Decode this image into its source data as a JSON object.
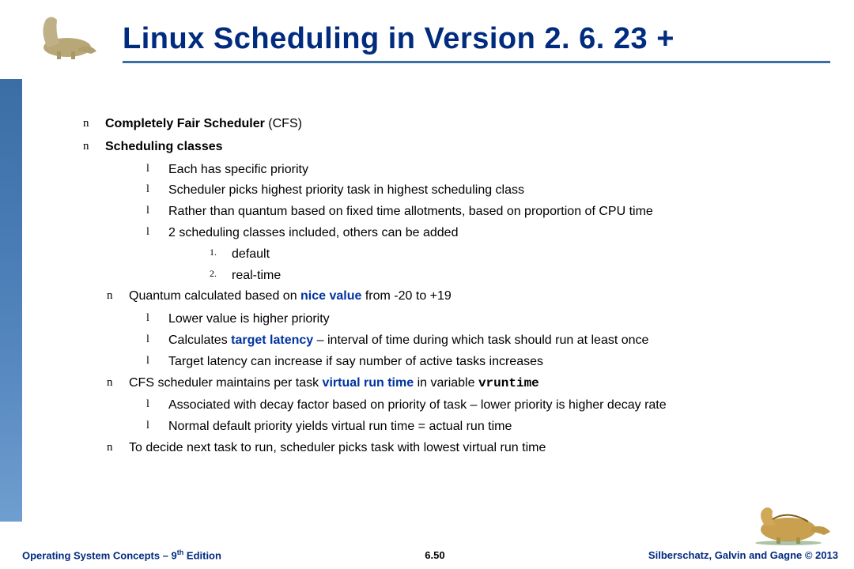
{
  "title": "Linux Scheduling in Version 2. 6. 23 +",
  "bullets": {
    "b1": "Completely Fair Scheduler",
    "b1_suffix": " (CFS)",
    "b2": "Scheduling classes",
    "b2_1": "Each has specific priority",
    "b2_2": "Scheduler picks highest priority task in highest scheduling class",
    "b2_3": "Rather than quantum based on fixed time allotments, based on proportion of CPU time",
    "b2_4": "2 scheduling classes included, others can be added",
    "b2_4_1n": "1.",
    "b2_4_1": "default",
    "b2_4_2n": "2.",
    "b2_4_2": "real-time",
    "b3_pre": "Quantum calculated based on ",
    "b3_bold": "nice value",
    "b3_post": " from -20 to +19",
    "b3_1": "Lower value is higher priority",
    "b3_2_pre": "Calculates ",
    "b3_2_bold": "target latency",
    "b3_2_post": " – interval of time during which task should run at least once",
    "b3_3": "Target latency can increase if say number of active tasks increases",
    "b4_pre": "CFS scheduler maintains per task ",
    "b4_bold": "virtual run time",
    "b4_mid": " in variable ",
    "b4_mono": "vruntime",
    "b4_1": "Associated with decay factor based on priority of task – lower priority is higher decay rate",
    "b4_2": "Normal default priority yields virtual run time = actual run time",
    "b5": "To decide next task to run, scheduler picks task with lowest virtual run time"
  },
  "footer": {
    "left_pre": "Operating System Concepts – 9",
    "left_sup": "th",
    "left_post": " Edition",
    "center": "6.50",
    "right": "Silberschatz, Galvin and Gagne © 2013"
  },
  "bullet_chars": {
    "n": "n",
    "l": "l"
  }
}
